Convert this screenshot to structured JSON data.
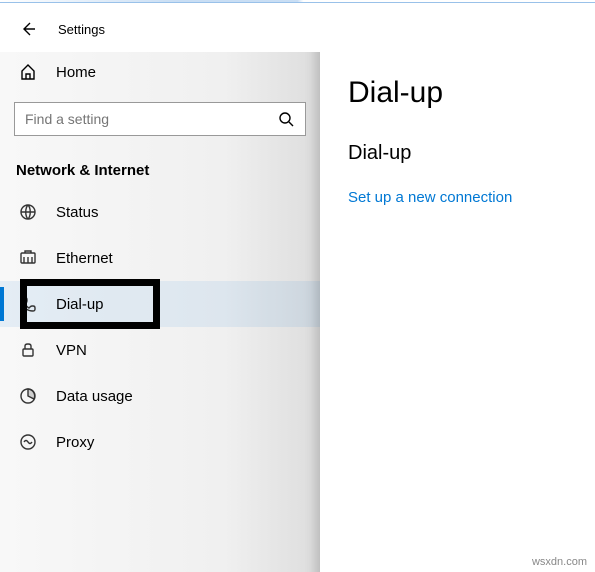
{
  "header": {
    "app_title": "Settings"
  },
  "sidebar": {
    "home_label": "Home",
    "search_placeholder": "Find a setting",
    "section_title": "Network & Internet",
    "items": [
      {
        "label": "Status"
      },
      {
        "label": "Ethernet"
      },
      {
        "label": "Dial-up"
      },
      {
        "label": "VPN"
      },
      {
        "label": "Data usage"
      },
      {
        "label": "Proxy"
      }
    ]
  },
  "content": {
    "page_title": "Dial-up",
    "subtitle": "Dial-up",
    "link_text": "Set up a new connection"
  },
  "watermark": "wsxdn.com"
}
